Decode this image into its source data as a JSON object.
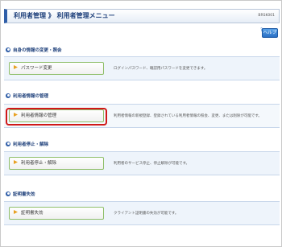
{
  "header": {
    "title": "利用者管理 》 利用者管理メニュー",
    "screen_id": "BRSK001"
  },
  "help": {
    "label": "ヘルプ",
    "mark": "?"
  },
  "sections": [
    {
      "heading": "自身の情報の変更・照会",
      "button": "パスワード変更",
      "description": "ログインパスワード、確認用パスワードを変更できます。"
    },
    {
      "heading": "利用者情報の管理",
      "button": "利用者情報の管理",
      "description": "利用者情報の新規登録、登録されている利用者情報の照会、変更、または削除が可能です。",
      "highlighted": true
    },
    {
      "heading": "利用者停止・解除",
      "button": "利用者停止・解除",
      "description": "利用者のサービス停止、停止解除が可能です。"
    },
    {
      "heading": "証明書失効",
      "button": "証明書失効",
      "description": "クライアント証明書の失効が可能です。"
    }
  ],
  "colors": {
    "accent": "#2f5ea8",
    "highlight": "#d01818",
    "button_border": "#8fbf6a"
  }
}
